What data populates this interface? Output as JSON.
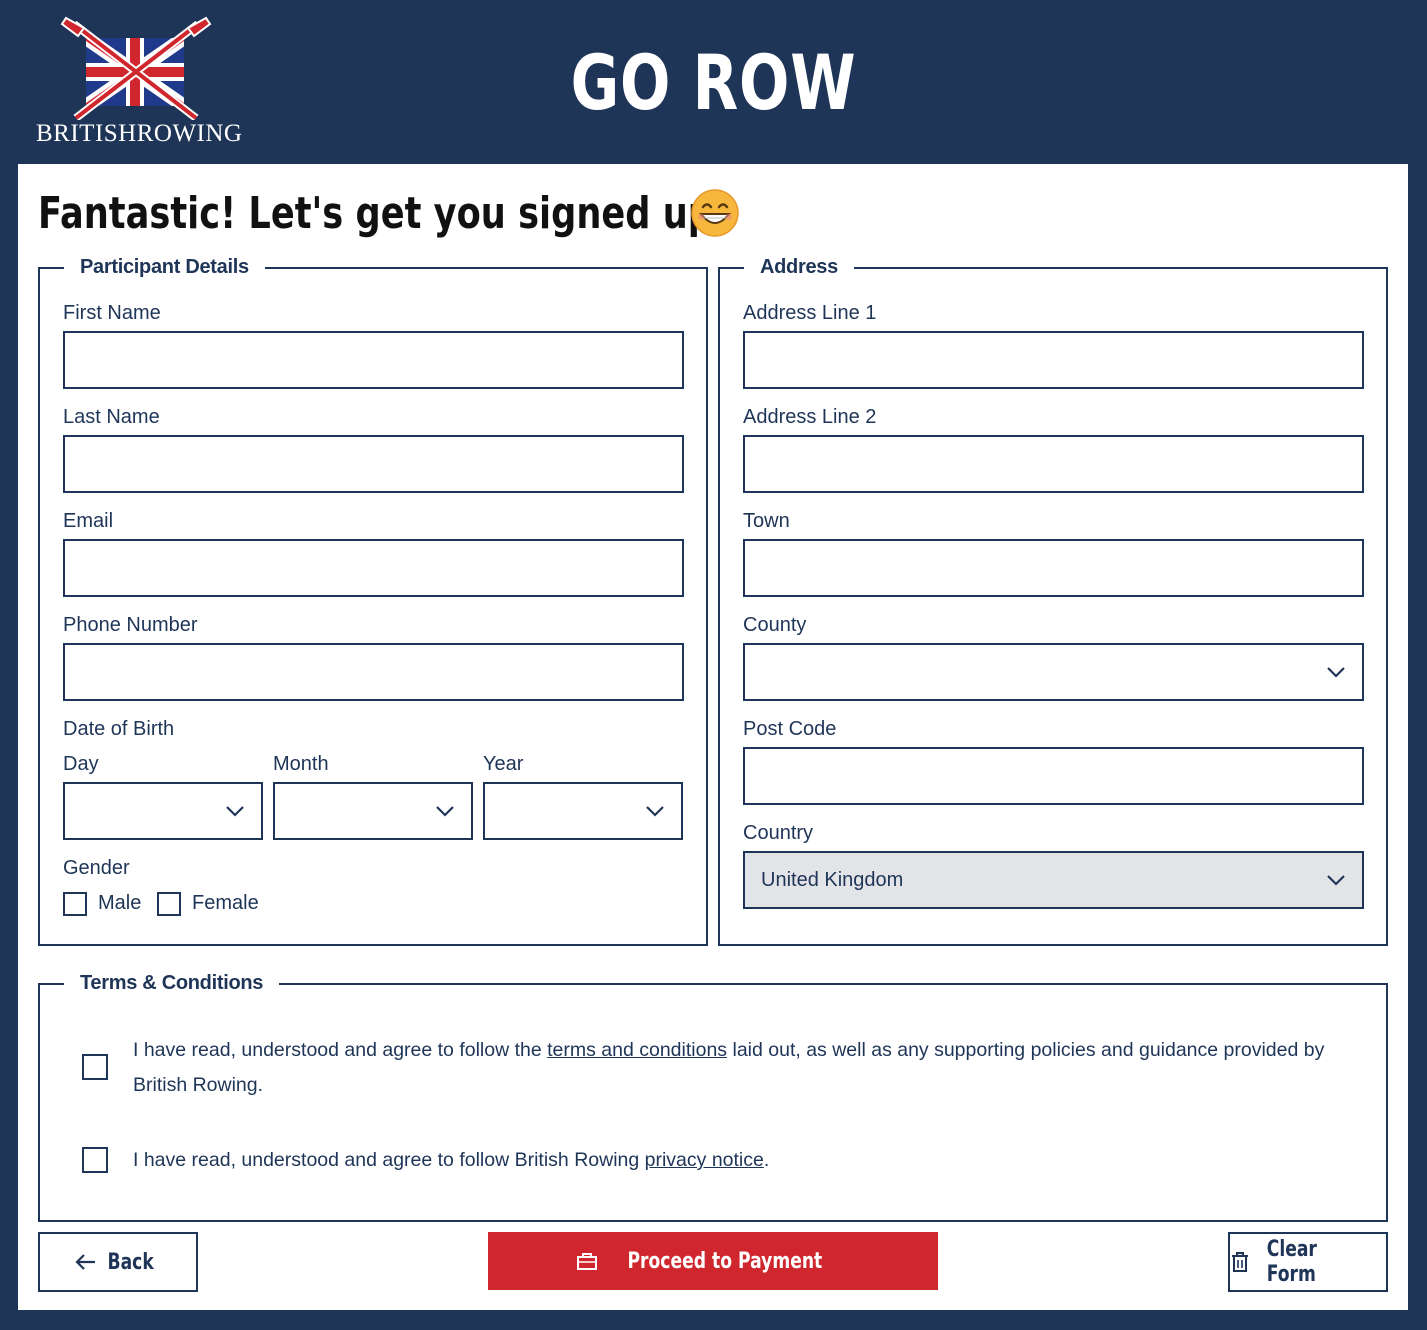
{
  "header": {
    "logo_text": "BRITISHROWING",
    "app_title": "GO ROW"
  },
  "main": {
    "heading": "Fantastic! Let's get you signed up.",
    "emoji_icon": "grinning-face-icon"
  },
  "participant": {
    "legend": "Participant Details",
    "first_name_label": "First Name",
    "first_name_value": "",
    "last_name_label": "Last Name",
    "last_name_value": "",
    "email_label": "Email",
    "email_value": "",
    "phone_label": "Phone Number",
    "phone_value": "",
    "dob_label": "Date of Birth",
    "day_label": "Day",
    "month_label": "Month",
    "year_label": "Year",
    "gender_label": "Gender",
    "male_label": "Male",
    "female_label": "Female"
  },
  "address": {
    "legend": "Address",
    "line1_label": "Address Line 1",
    "line2_label": "Address Line 2",
    "town_label": "Town",
    "county_label": "County",
    "postcode_label": "Post Code",
    "country_label": "Country",
    "country_value": "United Kingdom"
  },
  "terms": {
    "legend": "Terms & Conditions",
    "t1_pre": "I have read, understood and agree to follow the ",
    "t1_link": "terms and conditions",
    "t1_post": " laid out, as well as any supporting policies and guidance provided by British Rowing.",
    "t2_pre": "I have read, understood and agree to follow British Rowing ",
    "t2_link": "privacy notice",
    "t2_post": "."
  },
  "actions": {
    "back_label": "Back",
    "pay_label": "Proceed to Payment",
    "clear_label": "Clear Form"
  },
  "colors": {
    "navy": "#1f3558",
    "red": "#d0262d",
    "disabled_bg": "#e3e4e8"
  }
}
